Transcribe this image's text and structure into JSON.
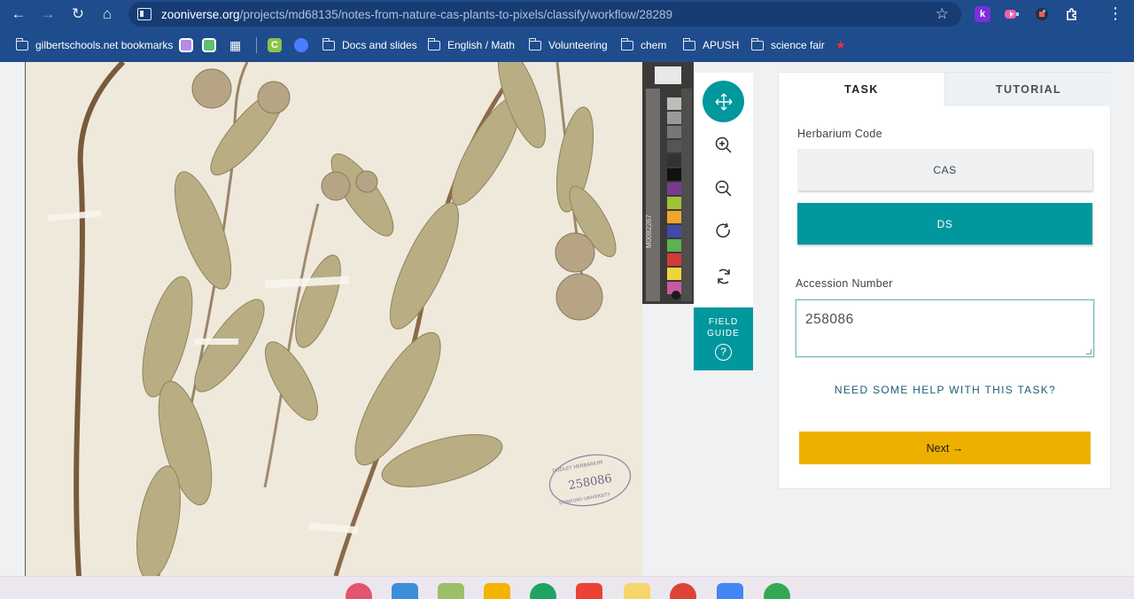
{
  "browser": {
    "url_host": "zooniverse.org",
    "url_path": "/projects/md68135/notes-from-nature-cas-plants-to-pixels/classify/workflow/28289",
    "bookmarks": [
      {
        "label": "gilbertschools.net bookmarks",
        "type": "folder-managed"
      },
      {
        "label": "Docs and slides",
        "type": "folder"
      },
      {
        "label": "English / Math",
        "type": "folder"
      },
      {
        "label": "Volunteering",
        "type": "folder"
      },
      {
        "label": "chem",
        "type": "folder"
      },
      {
        "label": "APUSH",
        "type": "folder"
      },
      {
        "label": "science fair",
        "type": "folder"
      }
    ],
    "extensions": [
      "k",
      "",
      "",
      ""
    ]
  },
  "specimen": {
    "stamp_number": "258086",
    "stamp_text": "DUDLEY HERBARIUM",
    "stamp_text_bottom": "STANFORD UNIVERSITY",
    "card_label": "M0082267"
  },
  "controls": {
    "items": [
      "move-icon",
      "zoom-in-icon",
      "zoom-out-icon",
      "rotate-icon",
      "reset-icon"
    ],
    "field_guide_label_1": "FIELD",
    "field_guide_label_2": "GUIDE",
    "field_guide_icon": "?"
  },
  "panel": {
    "tabs": {
      "task": "TASK",
      "tutorial": "TUTORIAL"
    },
    "herbarium_label": "Herbarium Code",
    "answers": [
      "CAS",
      "DS"
    ],
    "selected_answer": "DS",
    "accession_label": "Accession Number",
    "accession_value": "258086",
    "help_link": "NEED SOME HELP WITH THIS TASK?",
    "next_button": "Next →"
  },
  "colors": {
    "chrome": "#1f4c8c",
    "teal": "#00979d",
    "next": "#eeb000"
  }
}
